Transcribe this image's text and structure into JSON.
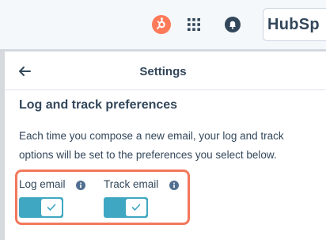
{
  "header": {
    "brand": "HubSp",
    "icons": [
      "hubspot-sprocket-icon",
      "apps-grid-icon",
      "notifications-bell-icon"
    ]
  },
  "panel": {
    "title": "Settings",
    "section_title": "Log and track preferences",
    "description": "Each time you compose a new email, your log and track options will be set to the preferences you select below."
  },
  "preferences": [
    {
      "label": "Log email",
      "enabled": true
    },
    {
      "label": "Track email",
      "enabled": true
    }
  ],
  "colors": {
    "accent_orange": "#ff7a59",
    "toggle_on": "#3fa7c1",
    "highlight": "#f2785c",
    "text": "#33475b"
  }
}
